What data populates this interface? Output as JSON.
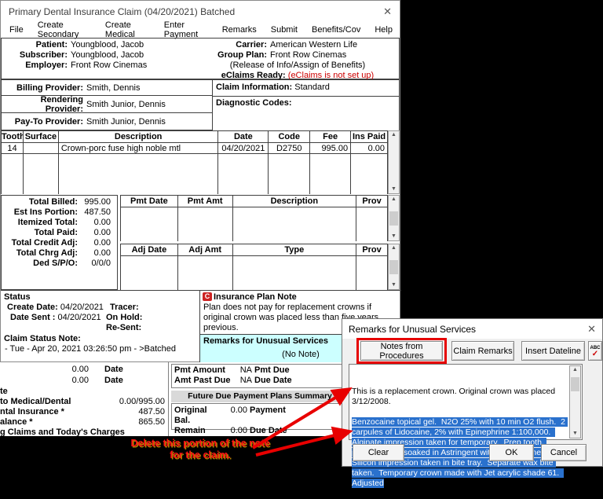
{
  "window": {
    "title": "Primary Dental Insurance Claim (04/20/2021) Batched",
    "close_glyph": "✕",
    "menu": [
      "File",
      "Create Secondary",
      "Create Medical",
      "Enter Payment",
      "Remarks",
      "Submit",
      "Benefits/Cov",
      "Help"
    ]
  },
  "patient_info": {
    "left": [
      {
        "label": "Patient:",
        "value": "Youngblood, Jacob"
      },
      {
        "label": "Subscriber:",
        "value": "Youngblood, Jacob"
      },
      {
        "label": "Employer:",
        "value": "Front Row Cinemas"
      }
    ],
    "right": [
      {
        "label": "Carrier:",
        "value": "American Western Life"
      },
      {
        "label": "Group Plan:",
        "value": "Front Row Cinemas"
      }
    ],
    "release_line": "(Release of Info/Assign of Benefits)",
    "eclaims_label": "eClaims Ready:",
    "eclaims_value": "(eClaims is not set up)"
  },
  "providers": [
    {
      "label": "Billing Provider:",
      "value": "Smith, Dennis"
    },
    {
      "label": "Rendering Provider:",
      "value": "Smith Junior, Dennis"
    },
    {
      "label": "Pay-To Provider:",
      "value": "Smith Junior, Dennis"
    }
  ],
  "claim_info": {
    "label": "Claim Information:",
    "value": "Standard"
  },
  "diagnostic_codes_label": "Diagnostic Codes:",
  "procedures": {
    "headers": [
      "Tooth",
      "Surface",
      "Description",
      "Date",
      "Code",
      "Fee",
      "Ins Paid"
    ],
    "rows": [
      {
        "tooth": "14",
        "surface": "",
        "description": "Crown-porc fuse high noble mtl",
        "date": "04/20/2021",
        "code": "D2750",
        "fee": "995.00",
        "ins_paid": "0.00"
      }
    ]
  },
  "totals": {
    "rows": [
      {
        "label": "Total Billed:",
        "value": "995.00"
      },
      {
        "label": "Est Ins Portion:",
        "value": "487.50"
      },
      {
        "label": "Itemized Total:",
        "value": "0.00"
      },
      {
        "label": "Total Paid:",
        "value": "0.00"
      },
      {
        "label": "Total Credit Adj:",
        "value": "0.00"
      },
      {
        "label": "Total Chrg Adj:",
        "value": "0.00"
      },
      {
        "label": "Ded S/P/O:",
        "value": "0/0/0"
      }
    ]
  },
  "payments": {
    "headers": [
      "Pmt Date",
      "Pmt Amt",
      "Description",
      "Prov"
    ]
  },
  "adjustments": {
    "headers": [
      "Adj Date",
      "Adj Amt",
      "Type",
      "Prov"
    ]
  },
  "status": {
    "title": "Status",
    "create_date_label": "Create Date:",
    "create_date": "04/20/2021",
    "tracer_label": "Tracer:",
    "date_sent_label": "Date Sent :",
    "date_sent": "04/20/2021",
    "on_hold_label": "On Hold:",
    "resent_label": "Re-Sent:",
    "note_label": "Claim Status Note:",
    "note": "- Tue - Apr 20, 2021 03:26:50 pm - >Batched"
  },
  "insurance_plan_note": {
    "title": "Insurance Plan Note",
    "text": "Plan does not pay for replacement crowns if original crown was placed less than five years previous."
  },
  "remarks_section": {
    "title": "Remarks for Unusual Services",
    "empty_text": "(No Note)"
  },
  "ledger": {
    "date_rows": [
      {
        "value": "0.00",
        "label": "Date"
      },
      {
        "value": "0.00",
        "label": "Date"
      }
    ],
    "cut_rows": [
      {
        "label": "te",
        "value": ""
      },
      {
        "label": " to Medical/Dental",
        "value": "0.00/995.00"
      },
      {
        "label": "ntal Insurance *",
        "value": "487.50"
      },
      {
        "label": "alance *",
        "value": "865.50"
      },
      {
        "label": "g Claims and Today's Charges",
        "value": ""
      }
    ],
    "payment_plan_rows": [
      {
        "label": "Pmt Amount",
        "value": "NA",
        "label2": "Pmt Due"
      },
      {
        "label": "Amt Past Due",
        "value": "NA",
        "label2": "Due Date"
      }
    ],
    "future_due_header": "Future Due Payment Plans Summary",
    "future_due_rows": [
      {
        "label": "Original Bal.",
        "value": "0.00",
        "label2": "Payment"
      },
      {
        "label": "Remain Bal.",
        "value": "0.00",
        "label2": "Due Date"
      }
    ]
  },
  "dialog": {
    "title": "Remarks for Unusual Services",
    "close_glyph": "✕",
    "buttons": {
      "notes_from_procedures": "Notes from Procedures",
      "claim_remarks": "Claim Remarks",
      "insert_dateline": "Insert Dateline"
    },
    "spellcheck_abc": "ABC",
    "spellcheck_check": "✓",
    "note_intro": "This is a replacement crown. Original crown was placed 3/12/2008.",
    "note_selected": "Benzocaine topical gel.  N2O 25% with 10 min O2 flush.  2 carpules of Lidocaine, 2% with Epinephrine 1:100,000.  Alginate impression taken for temporary.  Prep tooth, packed chord soaked in Astringent with Epinephrine.  Silicon impression taken in bite tray.  Separate wax bite taken.  Temporary crown made with Jet acrylic shade 61.  Adjusted",
    "footer": {
      "clear": "Clear",
      "ok": "OK",
      "cancel": "Cancel"
    }
  },
  "annotation": {
    "line1": "Delete this portion of the note",
    "line2": "for the claim."
  },
  "icons": {
    "up_arrow": "▲",
    "down_arrow": "▼",
    "note_glyph": "C"
  },
  "colors": {
    "selection": "#2a71cd",
    "error_red": "#cc0000",
    "annotation_red": "#ff1414",
    "remarks_bg": "#ccffff"
  }
}
